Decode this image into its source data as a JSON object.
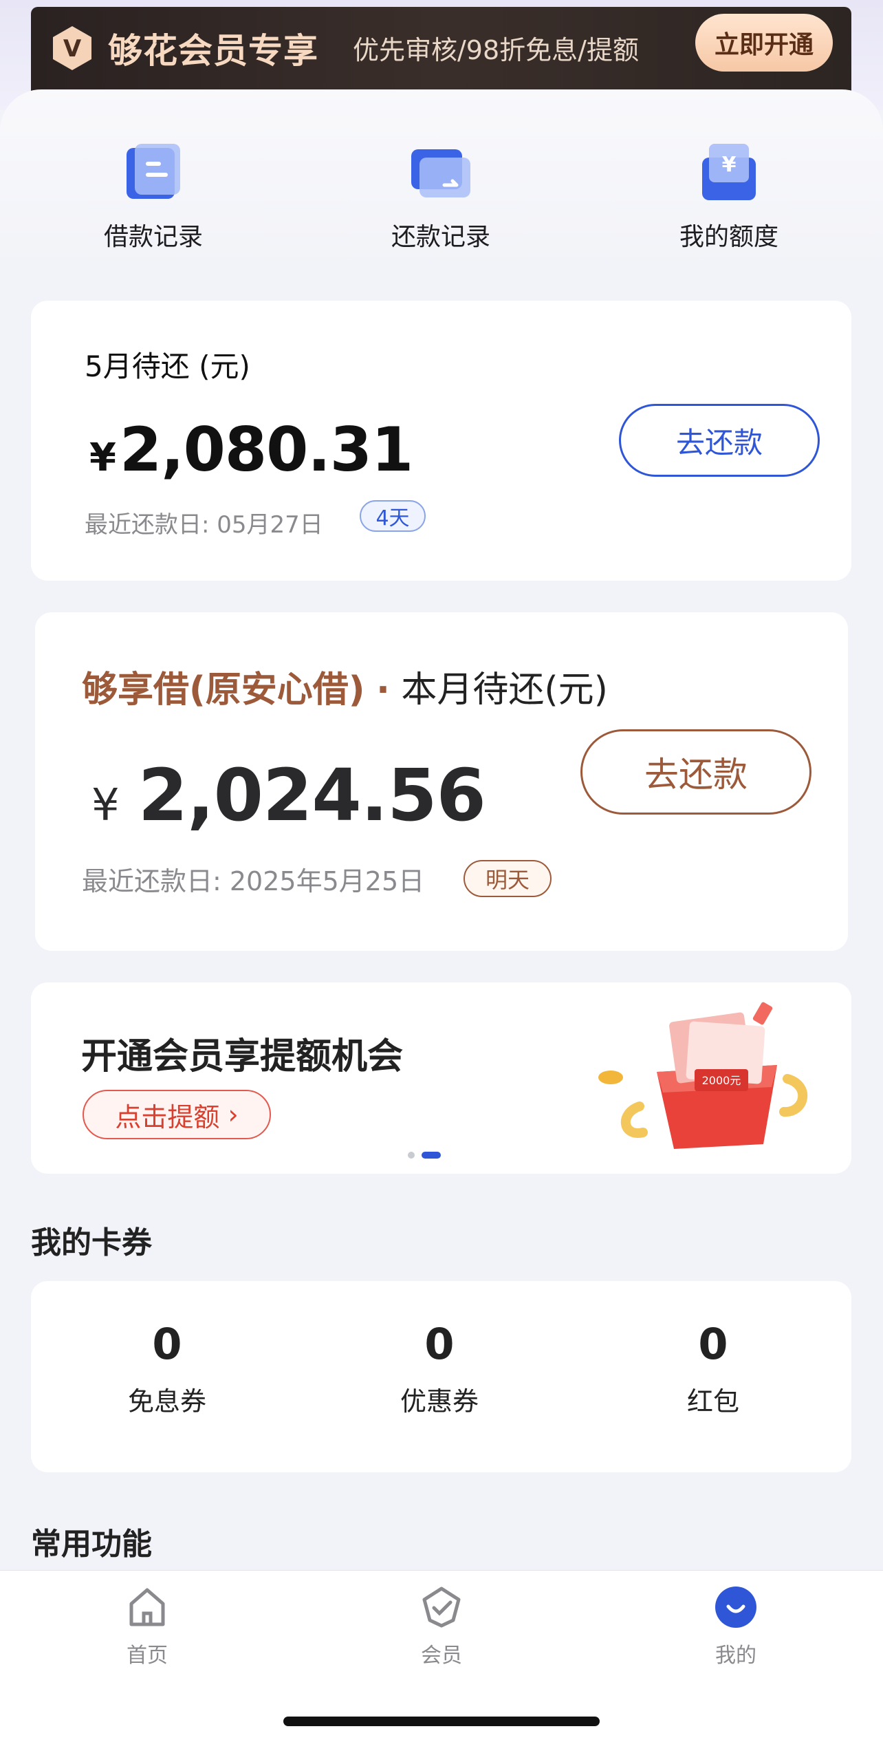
{
  "banner": {
    "badge_letter": "V",
    "title": "够花会员专享",
    "subtitle": "优先审核/98折免息/提额",
    "button": "立即开通"
  },
  "quick_links": [
    {
      "label": "借款记录",
      "icon": "loan-record-icon"
    },
    {
      "label": "还款记录",
      "icon": "repay-record-icon"
    },
    {
      "label": "我的额度",
      "icon": "credit-limit-icon"
    }
  ],
  "bill_card": {
    "title": "5月待还 (元)",
    "currency": "¥",
    "amount": "2,080.31",
    "due_label": "最近还款日: 05月27日",
    "chip": "4天",
    "button": "去还款"
  },
  "loan_card": {
    "brand": "够享借(原安心借)",
    "separator": "·",
    "title": "本月待还(元)",
    "currency": "¥",
    "amount": "2,024.56",
    "due_label": "最近还款日: 2025年5月25日",
    "chip": "明天",
    "button": "去还款"
  },
  "promo_card": {
    "title": "开通会员享提额机会",
    "button": "点击提额",
    "gift_text": "2000元"
  },
  "coupons": {
    "heading": "我的卡券",
    "items": [
      {
        "value": "0",
        "label": "免息券"
      },
      {
        "value": "0",
        "label": "优惠券"
      },
      {
        "value": "0",
        "label": "红包"
      }
    ]
  },
  "functions": {
    "heading": "常用功能"
  },
  "tabbar": {
    "items": [
      {
        "label": "首页",
        "icon": "home-icon"
      },
      {
        "label": "会员",
        "icon": "member-icon"
      },
      {
        "label": "我的",
        "icon": "profile-icon",
        "active": true
      }
    ]
  },
  "colors": {
    "accent_blue": "#2f56d6",
    "brand_brown": "#9c5a3a",
    "promo_red": "#d8402f"
  }
}
